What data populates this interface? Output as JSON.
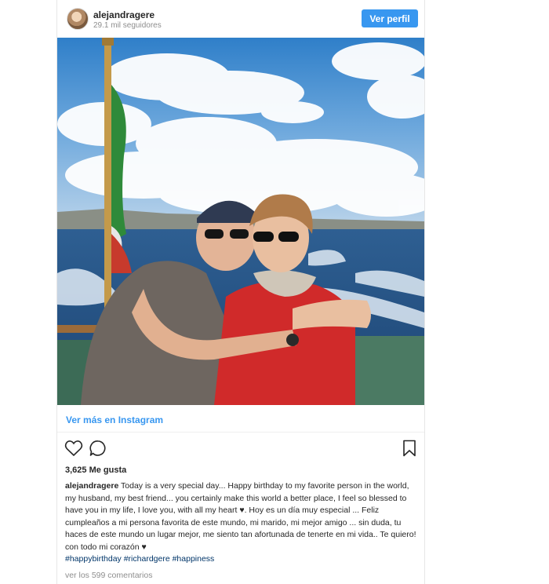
{
  "post": {
    "username": "alejandragere",
    "followers": "29.1 mil seguidores",
    "profile_button": "Ver perfil",
    "view_more": "Ver más en Instagram",
    "likes": "3,625 Me gusta",
    "caption_user": "alejandragere",
    "caption_text": "Today is a very special day... Happy birthday to my favorite person in the world, my husband, my best friend... you certainly make this world a better place, I feel so blessed to have you in my life, I love you, with all my heart ♥. Hoy es un día muy especial ... Feliz cumpleaños a mi persona favorita de este mundo, mi marido, mi mejor amigo ... sin duda, tu haces de este mundo un lugar mejor, me siento tan afortunada de tenerte en mi vida.. Te quiero! con todo mi corazón ♥",
    "hashtags": "#happybirthday #richardgere #happiness",
    "comments_link": "ver los 599 comentarios"
  },
  "icons": {
    "like": "heart-icon",
    "comment": "comment-bubble-icon",
    "save": "bookmark-icon",
    "avatar": "profile-avatar"
  },
  "colors": {
    "accent": "#3897f0",
    "hashtag": "#003569",
    "muted": "#8e8e8e"
  }
}
